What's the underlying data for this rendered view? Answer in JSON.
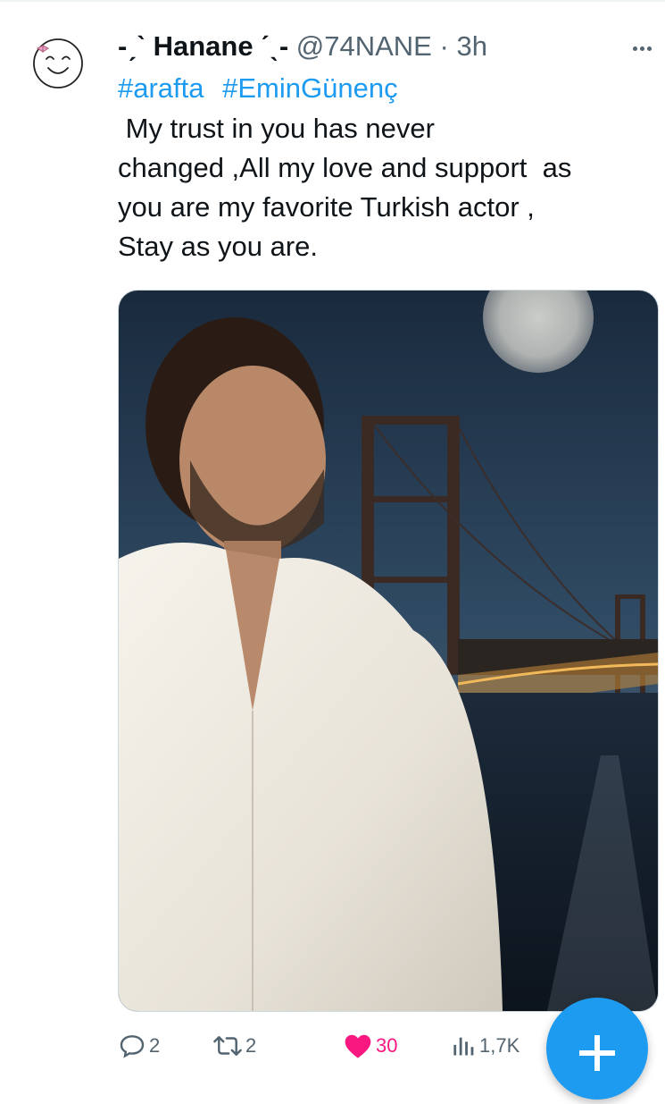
{
  "tweet": {
    "author": {
      "display_name": "-ˏˋ Hanane ˊˎ-",
      "handle": "@74NANE",
      "separator": "·",
      "time": "3h"
    },
    "hashtags": [
      "#arafta",
      "#EminGünenç"
    ],
    "text": " My trust in you has never\nchanged ,All my love and support  as\nyou are my favorite Turkish actor ,\nStay as you are.",
    "metrics": {
      "replies": "2",
      "retweets": "2",
      "likes": "30",
      "views": "1,7K"
    }
  },
  "colors": {
    "accent": "#1d9bf0",
    "like": "#f91880",
    "secondary_text": "#536471",
    "retweet": "#00ba7c"
  },
  "icons": {
    "reply": "speech-bubble-icon",
    "retweet": "retweet-arrows-icon",
    "like": "heart-icon",
    "views": "bar-chart-icon",
    "compose": "plus-icon",
    "more": "more-dots-icon"
  }
}
